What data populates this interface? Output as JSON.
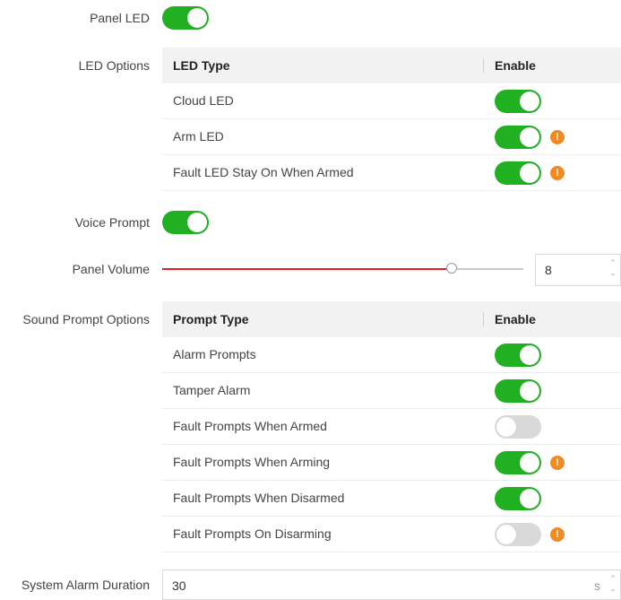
{
  "panel_led": {
    "label": "Panel LED",
    "enabled": true
  },
  "led_options": {
    "label": "LED Options",
    "header_type": "LED Type",
    "header_enable": "Enable",
    "rows": [
      {
        "name": "Cloud LED",
        "enabled": true,
        "warning": false
      },
      {
        "name": "Arm LED",
        "enabled": true,
        "warning": true
      },
      {
        "name": "Fault LED Stay On When Armed",
        "enabled": true,
        "warning": true
      }
    ]
  },
  "voice_prompt": {
    "label": "Voice Prompt",
    "enabled": true
  },
  "panel_volume": {
    "label": "Panel Volume",
    "value": "8"
  },
  "sound_prompt_options": {
    "label": "Sound Prompt Options",
    "header_type": "Prompt Type",
    "header_enable": "Enable",
    "rows": [
      {
        "name": "Alarm Prompts",
        "enabled": true,
        "warning": false
      },
      {
        "name": "Tamper Alarm",
        "enabled": true,
        "warning": false
      },
      {
        "name": "Fault Prompts When Armed",
        "enabled": false,
        "warning": false
      },
      {
        "name": "Fault Prompts When Arming",
        "enabled": true,
        "warning": true
      },
      {
        "name": "Fault Prompts When Disarmed",
        "enabled": true,
        "warning": false
      },
      {
        "name": "Fault Prompts On Disarming",
        "enabled": false,
        "warning": true
      }
    ]
  },
  "system_alarm_duration": {
    "label": "System Alarm Duration",
    "value": "30",
    "unit": "s"
  },
  "warning_glyph": "!",
  "colors": {
    "toggle_on": "#21b021",
    "toggle_off": "#d9d9d9",
    "warning": "#f08a24",
    "slider_fill": "#e02020"
  }
}
